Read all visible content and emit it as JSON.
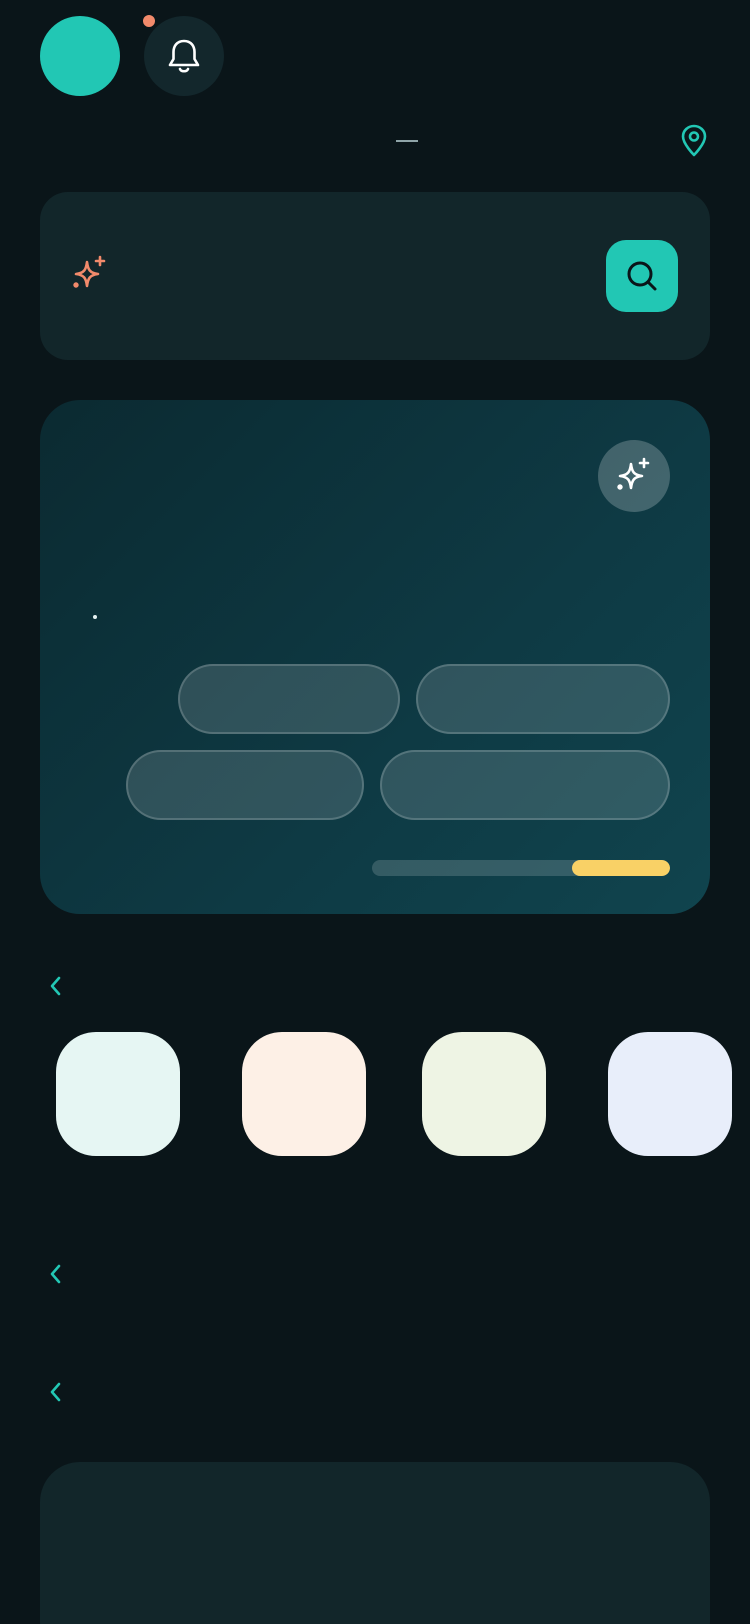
{
  "header": {
    "avatar_color": "#22c7b4",
    "has_notification": true,
    "notification_dot_color": "#f28a6b",
    "icons": [
      "bell-icon",
      "location-pin-icon"
    ]
  },
  "location": {
    "separator": "—",
    "icon": "location-pin-icon"
  },
  "search": {
    "placeholder": "",
    "leading_icon": "sparkle-icon",
    "button_icon": "search-icon",
    "accent_color": "#22c7b4"
  },
  "hero": {
    "action_icon": "sparkle-icon",
    "chips": [
      "",
      "",
      "",
      ""
    ],
    "progress": 0.33,
    "progress_color": "#f9d166"
  },
  "sections": [
    {
      "nav_icon": "chevron-left-icon"
    },
    {
      "nav_icon": "chevron-left-icon"
    },
    {
      "nav_icon": "chevron-left-icon"
    }
  ],
  "categories": [
    {
      "color": "#e6f6f3"
    },
    {
      "color": "#fdf0e6"
    },
    {
      "color": "#eef4e4"
    },
    {
      "color": "#e8eefa"
    }
  ],
  "colors": {
    "background": "#0a1519",
    "card": "#12262a",
    "accent": "#22c7b4",
    "warning": "#f9d166",
    "coral": "#f28a6b"
  }
}
